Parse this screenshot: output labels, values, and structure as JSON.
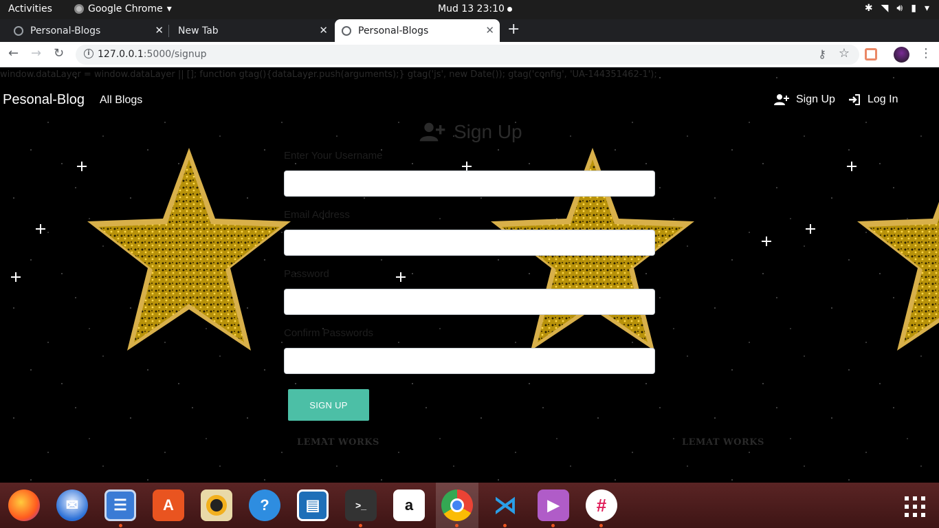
{
  "system": {
    "activities": "Activities",
    "app_name": "Google Chrome",
    "clock": "Mud 13  23:10"
  },
  "browser": {
    "tabs": [
      {
        "title": "Personal-Blogs",
        "active": false
      },
      {
        "title": "New Tab",
        "active": false
      },
      {
        "title": "Personal-Blogs",
        "active": true
      }
    ],
    "url_host": "127.0.0.1",
    "url_path": ":5000/signup"
  },
  "page": {
    "script_text": "window.dataLayer = window.dataLayer || []; function gtag(){dataLayer.push(arguments);} gtag('js', new Date()); gtag('config', 'UA-144351462-1');",
    "navbar": {
      "brand": "Pesonal-Blog",
      "all_blogs": "All Blogs",
      "sign_up": "Sign Up",
      "log_in": "Log In"
    },
    "form": {
      "title": "Sign Up",
      "username_label": "Enter Your Username",
      "email_label": "Email Address",
      "password_label": "Password",
      "confirm_label": "Confirm Passwords",
      "submit": "SIGN UP"
    },
    "watermark": "LEMAT WORKS"
  },
  "dock": {
    "apps": [
      "firefox-icon",
      "thunderbird-icon",
      "files-icon",
      "software-icon",
      "rhythmbox-icon",
      "help-icon",
      "writer-icon",
      "terminal-icon",
      "amazon-icon",
      "chrome-icon",
      "vscode-icon",
      "video-icon",
      "slack-icon"
    ]
  },
  "colors": {
    "accent_button": "#4cbfa6",
    "star_gold": "#b8920a"
  }
}
